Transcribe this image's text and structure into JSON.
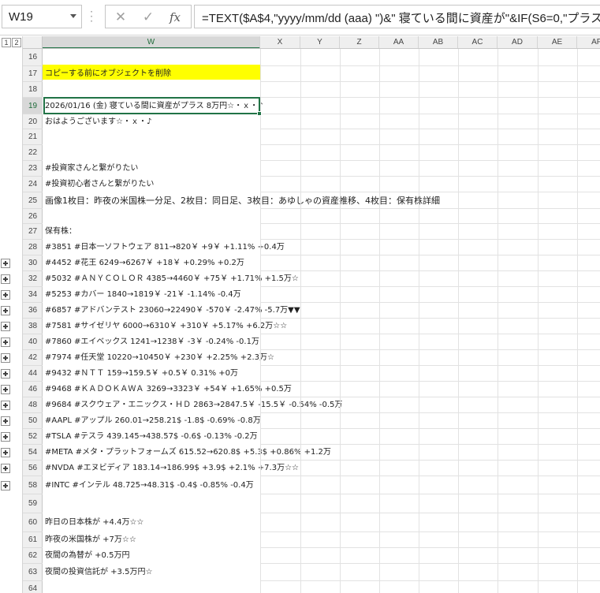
{
  "formula_bar": {
    "name_box": "W19",
    "formula": "=TEXT($A$4,\"yyyy/mm/dd (aaa) \")&\" 寝ている間に資産が\"&IF(S6=0,\"プラス",
    "cancel_icon": "close-icon",
    "enter_icon": "check-icon",
    "function_label": "fx"
  },
  "outline_levels": [
    "1",
    "2"
  ],
  "columns": [
    "W",
    "X",
    "Y",
    "Z",
    "AA",
    "AB",
    "AC",
    "AD",
    "AE",
    "AF"
  ],
  "selected_column": "W",
  "selected_row": "19",
  "rows": [
    {
      "num": "16",
      "text": ""
    },
    {
      "num": "17",
      "text": "コピーする前にオブジェクトを削除"
    },
    {
      "num": "18",
      "text": ""
    },
    {
      "num": "19",
      "text": "2026/01/16 (金) 寝ている間に資産がプラス 8万円☆・ｘ・♪"
    },
    {
      "num": "20",
      "text": "おはようございます☆・ｘ・♪"
    },
    {
      "num": "21",
      "text": ""
    },
    {
      "num": "22",
      "text": ""
    },
    {
      "num": "23",
      "text": "#投資家さんと繋がりたい"
    },
    {
      "num": "24",
      "text": "#投資初心者さんと繋がりたい"
    },
    {
      "num": "25",
      "text": "画像1枚目：昨夜の米国株一分足、2枚目：同日足、3枚目：あゆしゃの資産推移、4枚目：保有株詳細"
    },
    {
      "num": "26",
      "text": ""
    },
    {
      "num": "27",
      "text": "保有株："
    },
    {
      "num": "28",
      "text": "#3851 #日本一ソフトウェア 811→820￥ +9￥ +1.11% +0.4万"
    },
    {
      "num": "30",
      "text": "#4452 #花王 6249→6267￥ +18￥ +0.29% +0.2万"
    },
    {
      "num": "32",
      "text": "#5032 #ＡＮＹＣＯＬＯＲ 4385→4460￥ +75￥ +1.71% +1.5万☆"
    },
    {
      "num": "34",
      "text": "#5253 #カバー 1840→1819￥ -21￥ -1.14% -0.4万"
    },
    {
      "num": "36",
      "text": "#6857 #アドバンテスト 23060→22490￥ -570￥ -2.47% -5.7万▼▼"
    },
    {
      "num": "38",
      "text": "#7581 #サイゼリヤ 6000→6310￥ +310￥ +5.17% +6.2万☆☆"
    },
    {
      "num": "40",
      "text": "#7860 #エイベックス 1241→1238￥ -3￥ -0.24% -0.1万"
    },
    {
      "num": "42",
      "text": "#7974 #任天堂 10220→10450￥ +230￥ +2.25% +2.3万☆"
    },
    {
      "num": "44",
      "text": "#9432 #ＮＴＴ 159→159.5￥ +0.5￥ 0.31% +0万"
    },
    {
      "num": "46",
      "text": "#9468 #ＫＡＤＯＫＡＷＡ 3269→3323￥ +54￥ +1.65% +0.5万"
    },
    {
      "num": "48",
      "text": "#9684 #スクウェア・エニックス・ＨＤ 2863→2847.5￥ -15.5￥ -0.54% -0.5万"
    },
    {
      "num": "50",
      "text": "#AAPL #アップル 260.01→258.21$ -1.8$ -0.69% -0.8万"
    },
    {
      "num": "52",
      "text": "#TSLA #テスラ 439.145→438.57$ -0.6$ -0.13% -0.2万"
    },
    {
      "num": "54",
      "text": "#META #メタ・プラットフォームズ 615.52→620.8$ +5.3$ +0.86% +1.2万"
    },
    {
      "num": "56",
      "text": "#NVDA #エヌビディア 183.14→186.99$ +3.9$ +2.1% +7.3万☆☆"
    },
    {
      "num": "58",
      "text": "#INTC #インテル 48.725→48.31$ -0.4$ -0.85% -0.4万"
    },
    {
      "num": "59",
      "text": ""
    },
    {
      "num": "60",
      "text": "昨日の日本株が +4.4万☆☆"
    },
    {
      "num": "61",
      "text": "昨夜の米国株が +7万☆☆"
    },
    {
      "num": "62",
      "text": "夜間の為替が +0.5万円"
    },
    {
      "num": "63",
      "text": "夜間の投資信託が +3.5万円☆"
    },
    {
      "num": "64",
      "text": ""
    }
  ]
}
